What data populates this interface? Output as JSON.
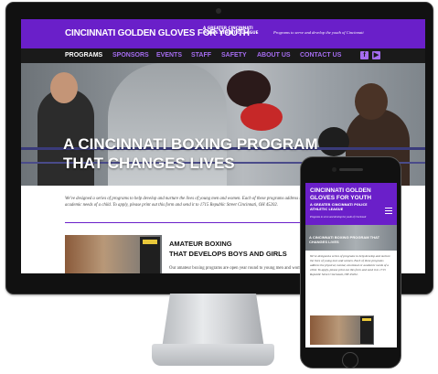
{
  "desktop": {
    "logo": "CINCINNATI GOLDEN GLOVES FOR YOUTH",
    "logo_sub": "A GREATER CINCINNATI POLICE ATHLETIC LEAGUE",
    "tagline": "Programs to serve and develop the youth of Cincinnati",
    "nav": [
      "PROGRAMS",
      "SPONSORS",
      "EVENTS",
      "STAFF",
      "SAFETY",
      "ABOUT US",
      "CONTACT US"
    ],
    "social": [
      "facebook-icon",
      "youtube-icon"
    ],
    "hero_title_line1": "A CINCINNATI BOXING PROGRAM",
    "hero_title_line2": "THAT CHANGES LIVES",
    "intro": "We've designed a series of programs to help develop and nurture the lives of young men and women. Each of these programs address the physical, mental, emotional or academic needs of a child. To apply, please print out this form and send it to 1715 Republic Street Cincinnati, OH 45202.",
    "program_title_line1": "AMATEUR BOXING",
    "program_title_line2": "THAT DEVELOPS BOYS AND GIRLS",
    "program_text": "Our amateur boxing programs are open year round to young men and women",
    "colors": {
      "brand": "#6a1fc9",
      "nav_bg": "#1a1a1a",
      "nav_link": "#a56cf0"
    }
  },
  "mobile": {
    "logo": "CINCINNATI GOLDEN GLOVES FOR YOUTH",
    "logo_sub": "A GREATER CINCINNATI POLICE ATHLETIC LEAGUE",
    "tagline": "Programs to serve and develop the youth of Cincinnati",
    "menu_icon": "hamburger-menu-icon",
    "hero_title": "A CINCINNATI BOXING PROGRAM THAT CHANGES LIVES",
    "intro": "We've designed a series of programs to help develop and nurture the lives of young men and women. Each of these programs address the physical, mental, emotional or academic needs of a child. To apply, please print out this form and send it to 1715 Republic Street Cincinnati, OH 45202."
  }
}
